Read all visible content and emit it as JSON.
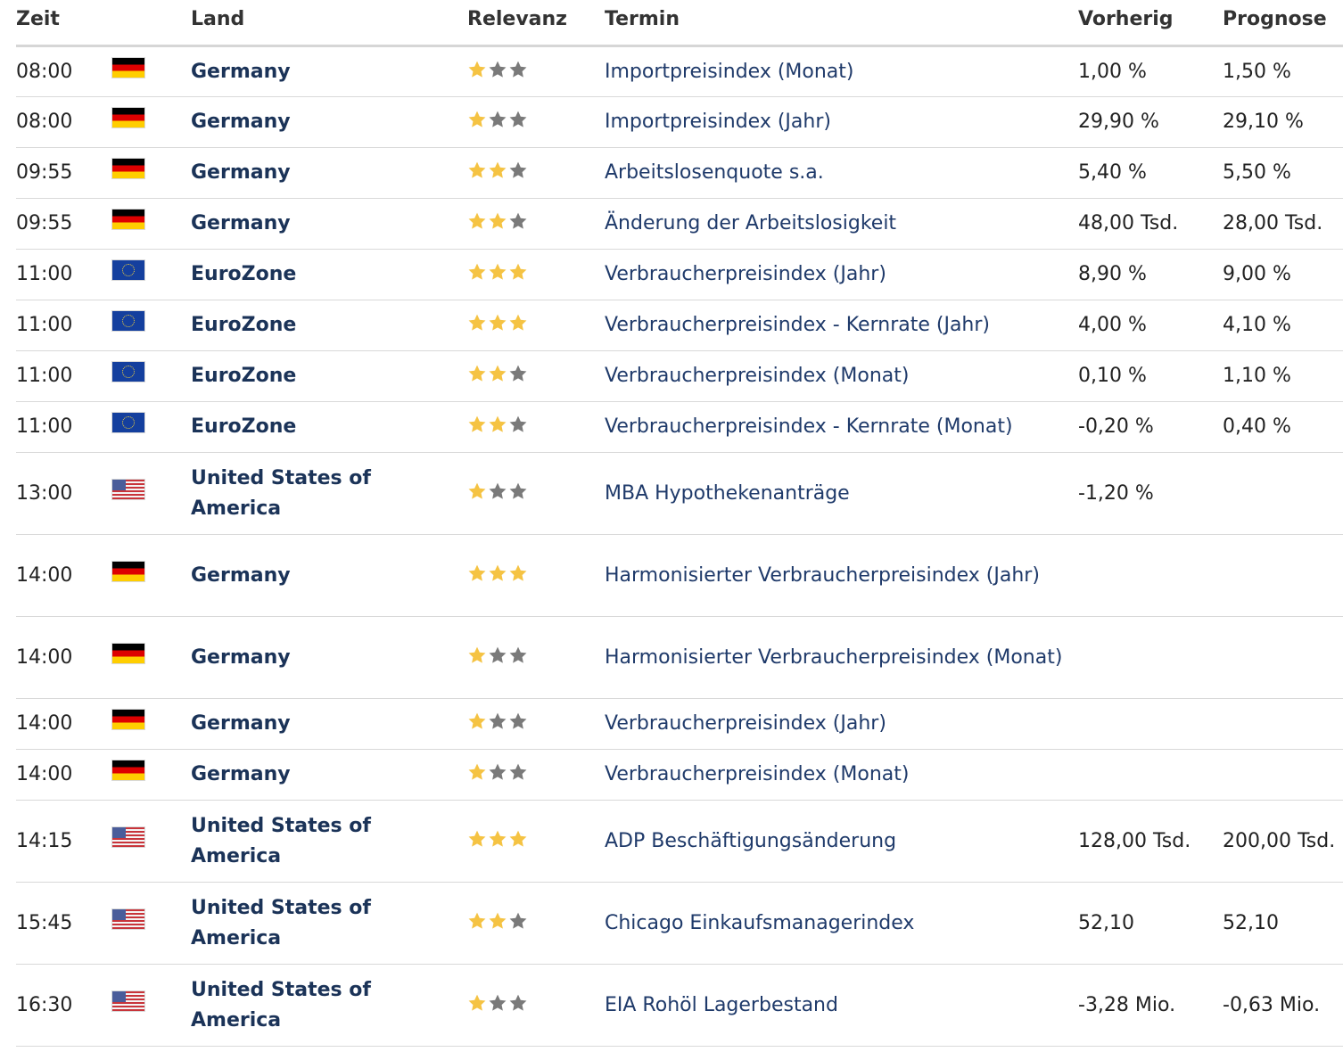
{
  "headers": {
    "zeit": "Zeit",
    "land": "Land",
    "relevanz": "Relevanz",
    "termin": "Termin",
    "vorherig": "Vorherig",
    "prognose": "Prognose"
  },
  "colors": {
    "star_filled": "#f5c343",
    "star_empty": "#7a7a7a"
  },
  "rows": [
    {
      "time": "08:00",
      "flag": "germany-flag-icon",
      "country": "Germany",
      "relevance": 1,
      "event": "Importpreisindex (Monat)",
      "previous": "1,00 %",
      "forecast": "1,50 %"
    },
    {
      "time": "08:00",
      "flag": "germany-flag-icon",
      "country": "Germany",
      "relevance": 1,
      "event": "Importpreisindex (Jahr)",
      "previous": "29,90 %",
      "forecast": "29,10 %"
    },
    {
      "time": "09:55",
      "flag": "germany-flag-icon",
      "country": "Germany",
      "relevance": 2,
      "event": "Arbeitslosenquote s.a.",
      "previous": "5,40 %",
      "forecast": "5,50 %"
    },
    {
      "time": "09:55",
      "flag": "germany-flag-icon",
      "country": "Germany",
      "relevance": 2,
      "event": "Änderung der Arbeitslosigkeit",
      "previous": "48,00 Tsd.",
      "forecast": "28,00 Tsd."
    },
    {
      "time": "11:00",
      "flag": "eu-flag-icon",
      "country": "EuroZone",
      "relevance": 3,
      "event": "Verbraucherpreisindex (Jahr)",
      "previous": "8,90 %",
      "forecast": "9,00 %"
    },
    {
      "time": "11:00",
      "flag": "eu-flag-icon",
      "country": "EuroZone",
      "relevance": 3,
      "event": "Verbraucherpreisindex - Kernrate (Jahr)",
      "previous": "4,00 %",
      "forecast": "4,10 %"
    },
    {
      "time": "11:00",
      "flag": "eu-flag-icon",
      "country": "EuroZone",
      "relevance": 2,
      "event": "Verbraucherpreisindex (Monat)",
      "previous": "0,10 %",
      "forecast": "1,10 %"
    },
    {
      "time": "11:00",
      "flag": "eu-flag-icon",
      "country": "EuroZone",
      "relevance": 2,
      "event": "Verbraucherpreisindex - Kernrate (Monat)",
      "previous": "-0,20 %",
      "forecast": "0,40 %"
    },
    {
      "time": "13:00",
      "flag": "usa-flag-icon",
      "country": "United States of America",
      "relevance": 1,
      "event": "MBA Hypothekenanträge",
      "previous": "-1,20 %",
      "forecast": ""
    },
    {
      "time": "14:00",
      "flag": "germany-flag-icon",
      "country": "Germany",
      "relevance": 3,
      "event": "Harmonisierter Verbraucherpreisindex (Jahr)",
      "previous": "",
      "forecast": ""
    },
    {
      "time": "14:00",
      "flag": "germany-flag-icon",
      "country": "Germany",
      "relevance": 1,
      "event": "Harmonisierter Verbraucherpreisindex (Monat)",
      "previous": "",
      "forecast": ""
    },
    {
      "time": "14:00",
      "flag": "germany-flag-icon",
      "country": "Germany",
      "relevance": 1,
      "event": "Verbraucherpreisindex (Jahr)",
      "previous": "",
      "forecast": ""
    },
    {
      "time": "14:00",
      "flag": "germany-flag-icon",
      "country": "Germany",
      "relevance": 1,
      "event": "Verbraucherpreisindex (Monat)",
      "previous": "",
      "forecast": ""
    },
    {
      "time": "14:15",
      "flag": "usa-flag-icon",
      "country": "United States of America",
      "relevance": 3,
      "event": "ADP Beschäftigungsänderung",
      "previous": "128,00 Tsd.",
      "forecast": "200,00 Tsd."
    },
    {
      "time": "15:45",
      "flag": "usa-flag-icon",
      "country": "United States of America",
      "relevance": 2,
      "event": "Chicago Einkaufsmanagerindex",
      "previous": "52,10",
      "forecast": "52,10"
    },
    {
      "time": "16:30",
      "flag": "usa-flag-icon",
      "country": "United States of America",
      "relevance": 1,
      "event": "EIA Rohöl Lagerbestand",
      "previous": "-3,28 Mio.",
      "forecast": "-0,63 Mio."
    }
  ]
}
